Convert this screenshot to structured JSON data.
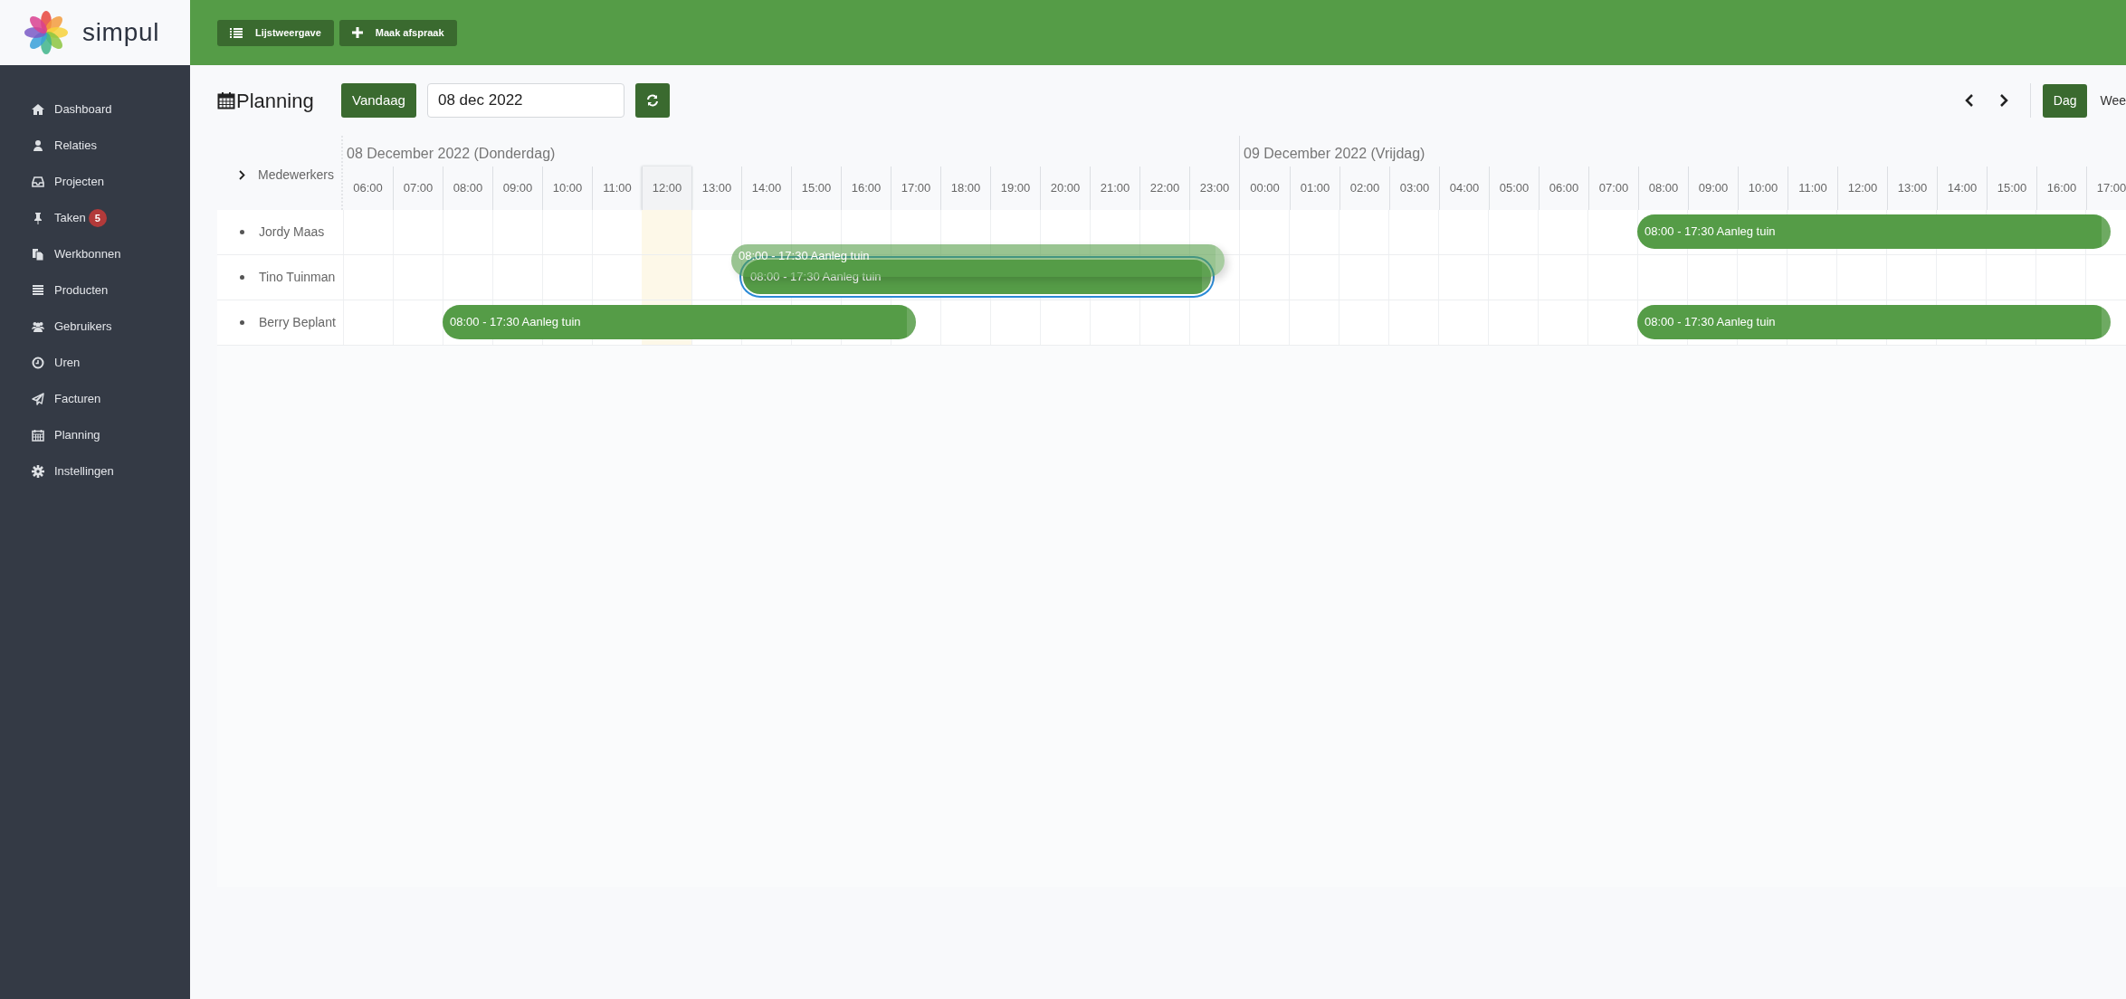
{
  "brand": {
    "name": "simpul"
  },
  "toolbar": [
    {
      "label": "Lijstweergave",
      "kind": "list"
    },
    {
      "label": "Maak afspraak",
      "kind": "plus"
    }
  ],
  "sidebar": {
    "items": [
      {
        "label": "Dashboard",
        "kind": "home"
      },
      {
        "label": "Relaties",
        "kind": "user"
      },
      {
        "label": "Projecten",
        "kind": "inbox"
      },
      {
        "label": "Taken",
        "kind": "pin",
        "badge": "5"
      },
      {
        "label": "Werkbonnen",
        "kind": "files"
      },
      {
        "label": "Producten",
        "kind": "list"
      },
      {
        "label": "Gebruikers",
        "kind": "users"
      },
      {
        "label": "Uren",
        "kind": "clock"
      },
      {
        "label": "Facturen",
        "kind": "plane"
      },
      {
        "label": "Planning",
        "kind": "calendar"
      },
      {
        "label": "Instellingen",
        "kind": "gear"
      }
    ]
  },
  "header": {
    "title": "Planning",
    "today_button": "Vandaag",
    "date_field": "08 dec 2022",
    "view_buttons": [
      {
        "label": "Dag",
        "selected": true
      },
      {
        "label": "Wee",
        "selected": false
      }
    ]
  },
  "timeline": {
    "resource_header": "Medewerkers",
    "days": [
      {
        "label": "08 December 2022 (Donderdag)",
        "hours": [
          {
            "label": "06:00",
            "current": false
          },
          {
            "label": "07:00",
            "current": false
          },
          {
            "label": "08:00",
            "current": false
          },
          {
            "label": "09:00",
            "current": false
          },
          {
            "label": "10:00",
            "current": false
          },
          {
            "label": "11:00",
            "current": false
          },
          {
            "label": "12:00",
            "current": true
          },
          {
            "label": "13:00",
            "current": false
          },
          {
            "label": "14:00",
            "current": false
          },
          {
            "label": "15:00",
            "current": false
          },
          {
            "label": "16:00",
            "current": false
          },
          {
            "label": "17:00",
            "current": false
          },
          {
            "label": "18:00",
            "current": false
          },
          {
            "label": "19:00",
            "current": false
          },
          {
            "label": "20:00",
            "current": false
          },
          {
            "label": "21:00",
            "current": false
          },
          {
            "label": "22:00",
            "current": false
          },
          {
            "label": "23:00",
            "current": false
          }
        ]
      },
      {
        "label": "09 December 2022 (Vrijdag)",
        "hours": [
          {
            "label": "00:00",
            "current": false
          },
          {
            "label": "01:00",
            "current": false
          },
          {
            "label": "02:00",
            "current": false
          },
          {
            "label": "03:00",
            "current": false
          },
          {
            "label": "04:00",
            "current": false
          },
          {
            "label": "05:00",
            "current": false
          },
          {
            "label": "06:00",
            "current": false
          },
          {
            "label": "07:00",
            "current": false
          },
          {
            "label": "08:00",
            "current": false
          },
          {
            "label": "09:00",
            "current": false
          },
          {
            "label": "10:00",
            "current": false
          },
          {
            "label": "11:00",
            "current": false
          },
          {
            "label": "12:00",
            "current": false
          },
          {
            "label": "13:00",
            "current": false
          },
          {
            "label": "14:00",
            "current": false
          },
          {
            "label": "15:00",
            "current": false
          },
          {
            "label": "16:00",
            "current": false
          },
          {
            "label": "17:00",
            "current": false
          }
        ]
      }
    ],
    "employees": [
      {
        "name": "Jordy Maas",
        "second_day_events": [
          {
            "kind": "normal",
            "label": "08:00 - 17:30 Aanleg tuin"
          }
        ]
      },
      {
        "name": "Tino Tuinman",
        "first_day_events": [
          {
            "kind": "ghost",
            "label": "08:00 - 17:30 Aanleg tuin"
          },
          {
            "kind": "selected",
            "label": "08:00 - 17:30 Aanleg tuin"
          }
        ]
      },
      {
        "name": "Berry Beplant",
        "first_day_events": [
          {
            "kind": "normal",
            "label": "08:00 - 17:30 Aanleg tuin"
          }
        ],
        "second_day_events": [
          {
            "kind": "normal",
            "label": "08:00 - 17:30 Aanleg tuin"
          }
        ]
      }
    ]
  }
}
